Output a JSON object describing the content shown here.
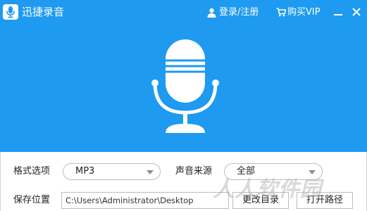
{
  "window": {
    "title": "迅捷录音",
    "icon": "microphone-icon",
    "accent": "#1e9af0",
    "login_label": "登录/注册",
    "vip_label": "购买VIP",
    "minimize_icon": "minimize-icon",
    "close_icon": "close-icon"
  },
  "settings": {
    "format_label": "格式选项",
    "format_value": "MP3",
    "source_label": "声音来源",
    "source_value": "全部",
    "save_label": "保存位置",
    "save_path": "C:\\Users\\Administrator\\Desktop",
    "change_dir_button": "更改目录",
    "open_path_button": "打开路径"
  },
  "watermark": {
    "text": "人人软件园"
  }
}
